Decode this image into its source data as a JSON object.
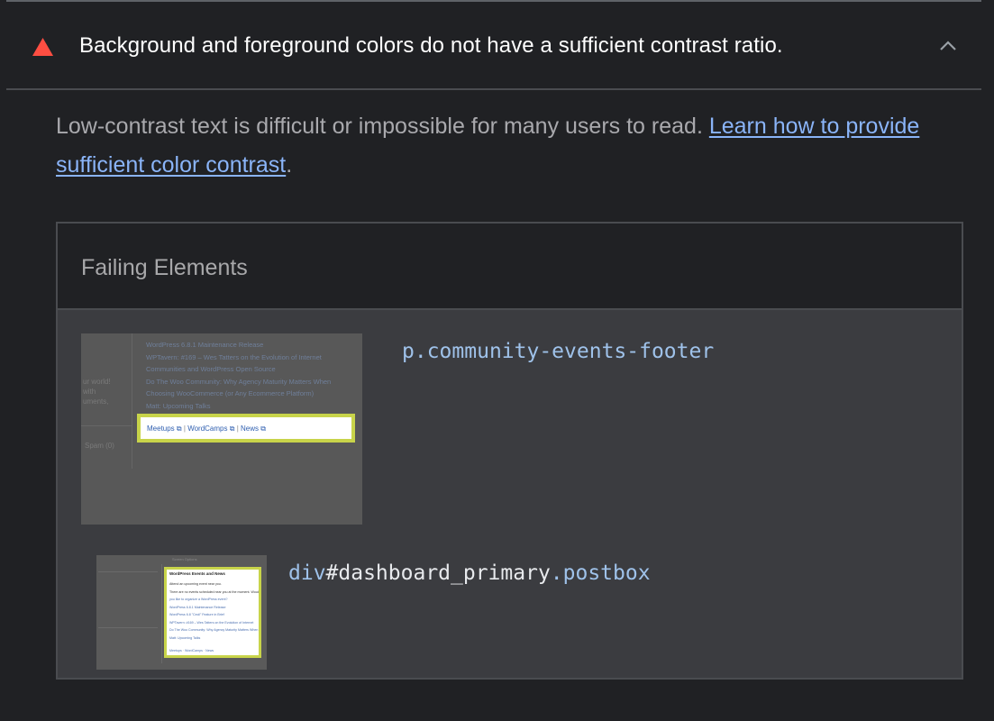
{
  "audit": {
    "title": "Background and foreground colors do not have a sufficient contrast ratio.",
    "description_text": "Low-contrast text is difficult or impossible for many users to read. ",
    "learn_more_link": "Learn how to provide sufficient color contrast",
    "description_end": ".",
    "status_color": "#ff4e42"
  },
  "failing": {
    "title": "Failing Elements",
    "items": [
      {
        "selector_tag": "p",
        "selector_rest": ".community-events-footer",
        "thumb": {
          "news_lines": [
            "WordPress 6.8.1 Maintenance Release",
            "WPTavern: #169 – Wes Tatters on the Evolution of Internet",
            "Communities and WordPress Open Source",
            "Do The Woo Community: Why Agency Maturity Matters When",
            "Choosing WooCommerce (or Any Ecommerce Platform)",
            "Matt: Upcoming Talks"
          ],
          "left_lines": [
            "ur world!",
            "with",
            "uments,"
          ],
          "spam": "Spam (0)",
          "footer_links": [
            "Meetups",
            "WordCamps",
            "News"
          ]
        }
      },
      {
        "selector_tag": "div",
        "selector_id": "#dashboard_primary",
        "selector_class": ".postbox",
        "thumb": {
          "panel_title": "WordPress Events and News",
          "screen_options": "Screen Options",
          "lines": [
            "Attend an upcoming event near you.",
            "There are no events scheduled near you at the moment. Would",
            "you like to organize a WordPress event?",
            "WordPress 6.8.1 Maintenance Release",
            "WordPress 6.8 \"Cecil\" Feature in Brief",
            "WPTavern: #169 – Wes Tatters on the Evolution of Internet",
            "Do The Woo Community: Why Agency Maturity Matters When",
            "Matt: Upcoming Talks"
          ],
          "footer_links": [
            "Meetups",
            "WordCamps",
            "News"
          ]
        }
      }
    ]
  },
  "colors": {
    "background": "#202124",
    "link": "#8ab4f8",
    "highlight": "#c8d44a"
  }
}
